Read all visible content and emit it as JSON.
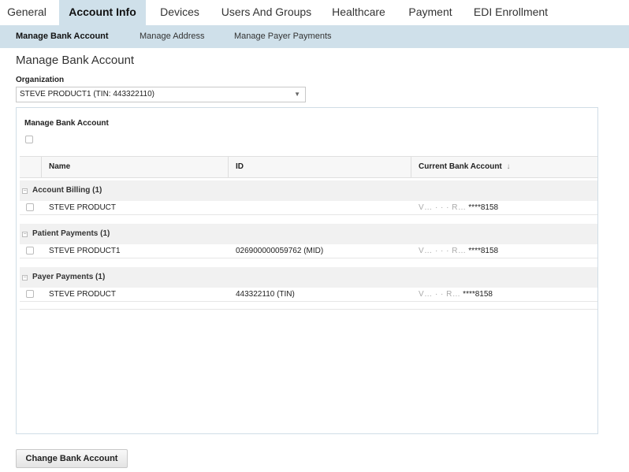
{
  "top_tabs": [
    {
      "label": "General"
    },
    {
      "label": "Account Info"
    },
    {
      "label": "Devices"
    },
    {
      "label": "Users And Groups"
    },
    {
      "label": "Healthcare"
    },
    {
      "label": "Payment"
    },
    {
      "label": "EDI Enrollment"
    }
  ],
  "sub_tabs": [
    {
      "label": "Manage Bank Account"
    },
    {
      "label": "Manage Address"
    },
    {
      "label": "Manage Payer Payments"
    }
  ],
  "page": {
    "title": "Manage Bank Account",
    "org_label": "Organization",
    "org_value": "STEVE PRODUCT1 (TIN: 443322110)"
  },
  "panel": {
    "title": "Manage Bank Account",
    "columns": {
      "name": "Name",
      "id": "ID",
      "current": "Current Bank Account"
    },
    "groups": [
      {
        "label": "Account Billing (1)",
        "rows": [
          {
            "name": "STEVE PRODUCT",
            "id": "",
            "obscured": "V… · · · R…",
            "account": "****8158"
          }
        ]
      },
      {
        "label": "Patient Payments (1)",
        "rows": [
          {
            "name": "STEVE PRODUCT1",
            "id": "026900000059762 (MID)",
            "obscured": "V… · · · R…",
            "account": "****8158"
          }
        ]
      },
      {
        "label": "Payer Payments (1)",
        "rows": [
          {
            "name": "STEVE PRODUCT",
            "id": "443322110 (TIN)",
            "obscured": "V… · · R…",
            "account": "****8158"
          }
        ]
      }
    ]
  },
  "button": {
    "label": "Change Bank Account"
  }
}
